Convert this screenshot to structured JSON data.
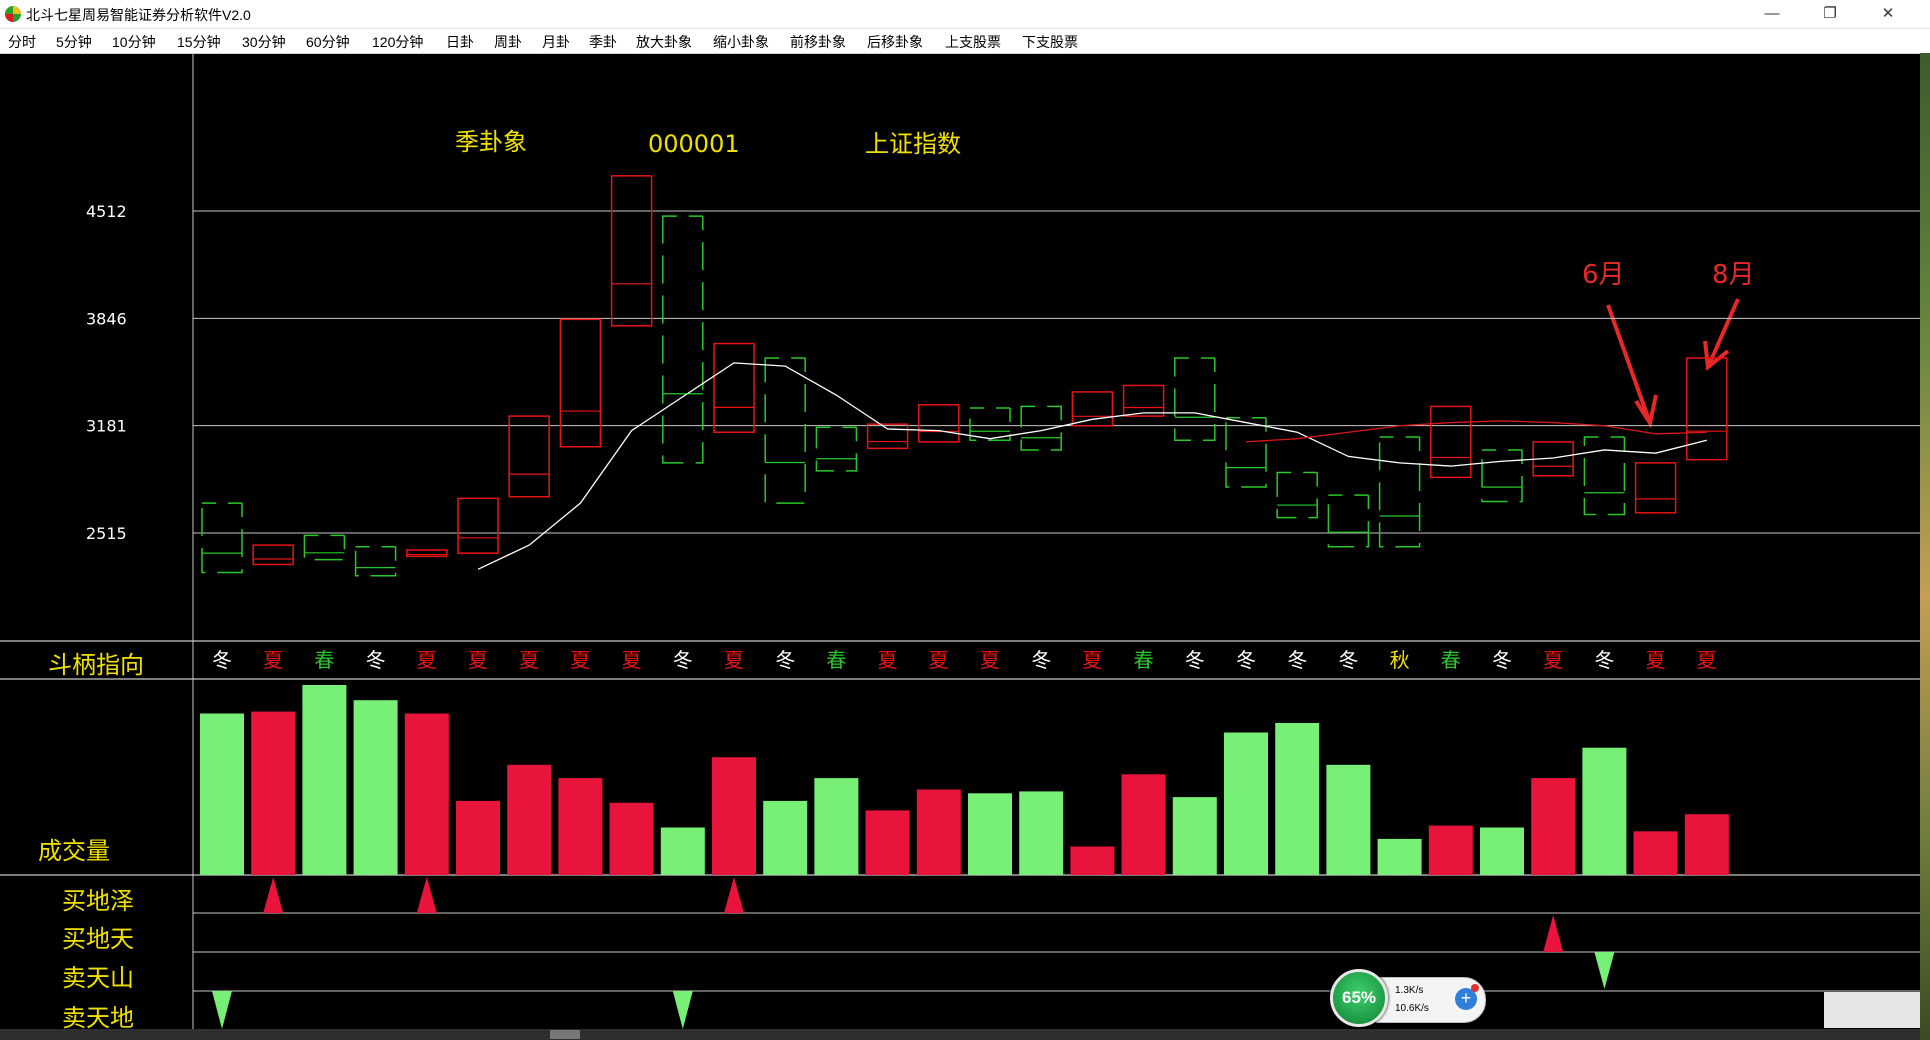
{
  "window": {
    "title": "北斗七星周易智能证券分析软件V2.0",
    "minimize_glyph": "—",
    "restore_glyph": "❐",
    "close_glyph": "✕"
  },
  "menu": [
    "分时",
    "5分钟",
    "10分钟",
    "15分钟",
    "30分钟",
    "60分钟",
    "120分钟",
    "日卦",
    "周卦",
    "月卦",
    "季卦",
    "放大卦象",
    "缩小卦象",
    "前移卦象",
    "后移卦象",
    "上支股票",
    "下支股票"
  ],
  "colors": {
    "up": "#e8143c",
    "down": "#78f078",
    "up_outline": "#e81414",
    "down_outline": "#28c828",
    "label_yellow": "#f0e000",
    "grid": "#c8c8c8",
    "ma_line": "#ffffff",
    "ma2_line": "#d81818",
    "annotation": "#e82828",
    "season": {
      "冬": "#ffffff",
      "夏": "#e81414",
      "春": "#28c828",
      "秋": "#f0e000"
    }
  },
  "header": {
    "period_label": "季卦象",
    "stock_code": "000001",
    "stock_name": "上证指数"
  },
  "y_axis": {
    "ticks": [
      4512,
      3846,
      3181,
      2515
    ]
  },
  "annotations": [
    {
      "text": "6月"
    },
    {
      "text": "8月"
    }
  ],
  "panel_labels": {
    "dipper": "斗柄指向",
    "volume": "成交量",
    "signal_rows": [
      "买地泽",
      "买地天",
      "卖天山",
      "卖天地"
    ]
  },
  "chart_data": {
    "type": "candlestick",
    "y_scale": {
      "ref_ticks": [
        2515,
        3181,
        3846,
        4512
      ]
    },
    "candles": [
      {
        "open": 2700,
        "high": 2700,
        "low": 2270,
        "close": 2270,
        "dir": "down"
      },
      {
        "open": 2320,
        "high": 2500,
        "low": 2320,
        "close": 2440,
        "dir": "up"
      },
      {
        "open": 2500,
        "high": 2500,
        "low": 2330,
        "close": 2350,
        "dir": "down"
      },
      {
        "open": 2430,
        "high": 2430,
        "low": 2250,
        "close": 2250,
        "dir": "down"
      },
      {
        "open": 2370,
        "high": 2410,
        "low": 2370,
        "close": 2410,
        "dir": "up"
      },
      {
        "open": 2390,
        "high": 2730,
        "low": 2390,
        "close": 2730,
        "dir": "up"
      },
      {
        "open": 2740,
        "high": 3240,
        "low": 2740,
        "close": 3240,
        "dir": "up"
      },
      {
        "open": 3050,
        "high": 3840,
        "low": 3050,
        "close": 3840,
        "dir": "up"
      },
      {
        "open": 3800,
        "high": 4730,
        "low": 3800,
        "close": 4730,
        "dir": "up"
      },
      {
        "open": 4480,
        "high": 4480,
        "low": 2950,
        "close": 2950,
        "dir": "down"
      },
      {
        "open": 3140,
        "high": 3690,
        "low": 3140,
        "close": 3690,
        "dir": "up"
      },
      {
        "open": 3600,
        "high": 3600,
        "low": 2700,
        "close": 2700,
        "dir": "down"
      },
      {
        "open": 3170,
        "high": 3170,
        "low": 2900,
        "close": 2900,
        "dir": "down"
      },
      {
        "open": 3040,
        "high": 3190,
        "low": 3040,
        "close": 3190,
        "dir": "up"
      },
      {
        "open": 3080,
        "high": 3310,
        "low": 3080,
        "close": 3310,
        "dir": "up"
      },
      {
        "open": 3290,
        "high": 3290,
        "low": 3090,
        "close": 3090,
        "dir": "down"
      },
      {
        "open": 3300,
        "high": 3300,
        "low": 3030,
        "close": 3030,
        "dir": "down"
      },
      {
        "open": 3180,
        "high": 3390,
        "low": 3180,
        "close": 3390,
        "dir": "up"
      },
      {
        "open": 3240,
        "high": 3430,
        "low": 3240,
        "close": 3430,
        "dir": "up"
      },
      {
        "open": 3600,
        "high": 3600,
        "low": 3090,
        "close": 3090,
        "dir": "down"
      },
      {
        "open": 3230,
        "high": 3230,
        "low": 2800,
        "close": 2800,
        "dir": "down"
      },
      {
        "open": 2890,
        "high": 2890,
        "low": 2610,
        "close": 2610,
        "dir": "down"
      },
      {
        "open": 2750,
        "high": 2750,
        "low": 2430,
        "close": 2430,
        "dir": "down"
      },
      {
        "open": 3110,
        "high": 3110,
        "low": 2430,
        "close": 2430,
        "dir": "down"
      },
      {
        "open": 2860,
        "high": 3300,
        "low": 2860,
        "close": 3300,
        "dir": "up"
      },
      {
        "open": 3030,
        "high": 3030,
        "low": 2710,
        "close": 2710,
        "dir": "down"
      },
      {
        "open": 2870,
        "high": 3080,
        "low": 2870,
        "close": 3080,
        "dir": "up"
      },
      {
        "open": 3110,
        "high": 3110,
        "low": 2630,
        "close": 2630,
        "dir": "down"
      },
      {
        "open": 2640,
        "high": 2950,
        "low": 2640,
        "close": 2950,
        "dir": "up"
      },
      {
        "open": 2970,
        "high": 3600,
        "low": 2970,
        "close": 3600,
        "dir": "up"
      }
    ],
    "ma_white": [
      null,
      null,
      null,
      null,
      null,
      2290,
      2440,
      2700,
      3150,
      3360,
      3570,
      3550,
      3370,
      3160,
      3150,
      3100,
      3150,
      3220,
      3260,
      3260,
      3200,
      3140,
      2990,
      2950,
      2930,
      2960,
      2980,
      3030,
      3010,
      3090
    ],
    "ma_red": [
      null,
      null,
      null,
      null,
      null,
      null,
      null,
      null,
      null,
      null,
      null,
      null,
      null,
      null,
      null,
      null,
      null,
      null,
      null,
      null,
      3080,
      3100,
      3140,
      3180,
      3200,
      3210,
      3200,
      3180,
      3130,
      3140
    ],
    "seasons": [
      "冬",
      "夏",
      "春",
      "冬",
      "夏",
      "夏",
      "夏",
      "夏",
      "夏",
      "冬",
      "夏",
      "冬",
      "春",
      "夏",
      "夏",
      "夏",
      "冬",
      "夏",
      "春",
      "冬",
      "冬",
      "冬",
      "冬",
      "秋",
      "春",
      "冬",
      "夏",
      "冬",
      "夏",
      "夏"
    ],
    "volume": [
      0.85,
      0.86,
      1.0,
      0.92,
      0.85,
      0.39,
      0.58,
      0.51,
      0.38,
      0.25,
      0.62,
      0.39,
      0.51,
      0.34,
      0.45,
      0.43,
      0.44,
      0.15,
      0.53,
      0.41,
      0.75,
      0.8,
      0.58,
      0.19,
      0.26,
      0.25,
      0.51,
      0.67,
      0.23,
      0.32
    ],
    "signals": [
      {
        "row": 0,
        "index": 1,
        "type": "buy"
      },
      {
        "row": 0,
        "index": 4,
        "type": "buy"
      },
      {
        "row": 0,
        "index": 10,
        "type": "buy"
      },
      {
        "row": 1,
        "index": 26,
        "type": "buy"
      },
      {
        "row": 2,
        "index": 27,
        "type": "sell"
      },
      {
        "row": 3,
        "index": 0,
        "type": "sell"
      },
      {
        "row": 3,
        "index": 9,
        "type": "sell"
      }
    ]
  },
  "net_widget": {
    "percent": "65%",
    "upload": "1.3K/s",
    "download": "10.6K/s",
    "up_glyph": "↑",
    "down_glyph": "↓",
    "plus_glyph": "+"
  }
}
